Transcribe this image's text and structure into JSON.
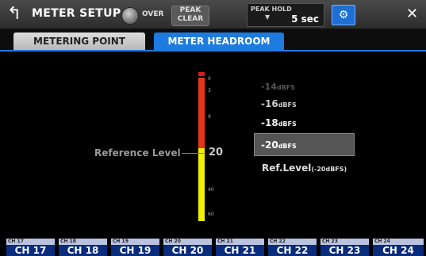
{
  "header": {
    "back_icon": "back-arrow-icon",
    "title": "METER SETUP",
    "over_label": "OVER",
    "peak_clear_line1": "PEAK",
    "peak_clear_line2": "CLEAR",
    "peak_hold_label": "PEAK HOLD",
    "peak_hold_arrow": "▼",
    "peak_hold_value": "5 sec",
    "gear_icon": "gear-icon",
    "close_icon": "close-icon"
  },
  "tabs": [
    {
      "label": "METERING POINT",
      "active": false
    },
    {
      "label": "METER HEADROOM",
      "active": true
    }
  ],
  "meter": {
    "ticks": [
      "0",
      "3",
      "9",
      "20",
      "40",
      "60"
    ],
    "reference_label": "Reference Level",
    "reference_value": "20"
  },
  "headroom_options": {
    "opt_14": "-14",
    "opt_16": "-16",
    "opt_18": "-18",
    "opt_20": "-20",
    "unit": "dBFS",
    "selected": "-20"
  },
  "ref_level": {
    "label": "Ref.Level",
    "suffix": "(-20dBFS)"
  },
  "channels": [
    {
      "small": "CH 17",
      "big": "CH 17"
    },
    {
      "small": "CH 18",
      "big": "CH 18"
    },
    {
      "small": "CH 19",
      "big": "CH 19"
    },
    {
      "small": "CH 20",
      "big": "CH 20"
    },
    {
      "small": "CH 21",
      "big": "CH 21"
    },
    {
      "small": "CH 22",
      "big": "CH 22"
    },
    {
      "small": "CH 23",
      "big": "CH 23"
    },
    {
      "small": "CH 24",
      "big": "CH 24"
    }
  ],
  "colors": {
    "accent": "#1e7be0",
    "meter_red": "#e4361a",
    "meter_yellow": "#f0f000",
    "channel_bg": "#0a2c7c"
  }
}
